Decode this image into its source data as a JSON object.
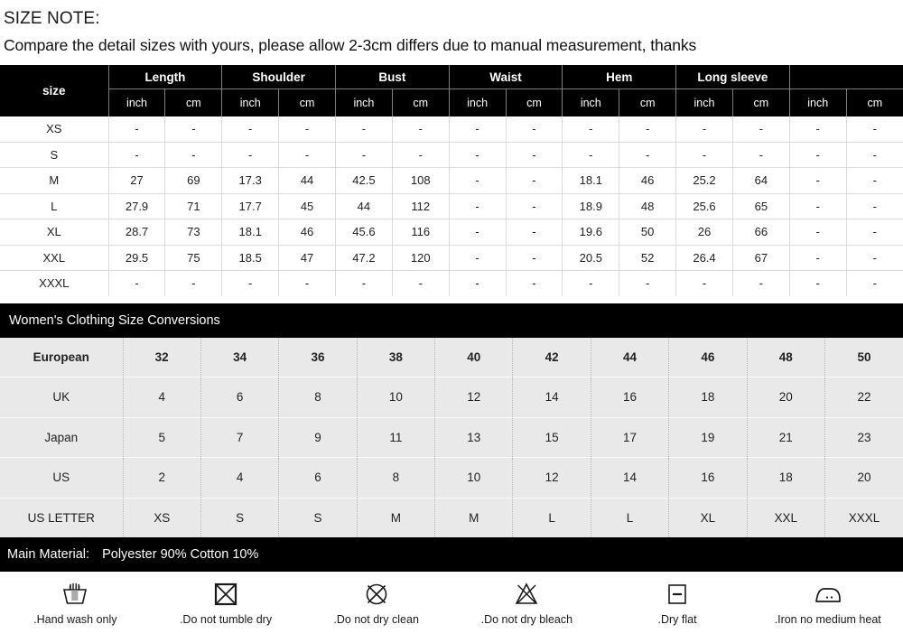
{
  "note": {
    "title": "SIZE NOTE:",
    "text": "Compare the detail sizes with yours, please allow 2-3cm differs due to manual measurement, thanks"
  },
  "size_table": {
    "size_header": "size",
    "groups": [
      {
        "label": "Length",
        "sub": [
          "inch",
          "cm"
        ]
      },
      {
        "label": "Shoulder",
        "sub": [
          "inch",
          "cm"
        ]
      },
      {
        "label": "Bust",
        "sub": [
          "inch",
          "cm"
        ]
      },
      {
        "label": "Waist",
        "sub": [
          "inch",
          "cm"
        ]
      },
      {
        "label": "Hem",
        "sub": [
          "inch",
          "cm"
        ]
      },
      {
        "label": "Long sleeve",
        "sub": [
          "inch",
          "cm"
        ]
      },
      {
        "label": "",
        "sub": [
          "inch",
          "cm"
        ]
      }
    ],
    "rows": [
      {
        "size": "XS",
        "values": [
          "-",
          "-",
          "-",
          "-",
          "-",
          "-",
          "-",
          "-",
          "-",
          "-",
          "-",
          "-",
          "-",
          "-"
        ]
      },
      {
        "size": "S",
        "values": [
          "-",
          "-",
          "-",
          "-",
          "-",
          "-",
          "-",
          "-",
          "-",
          "-",
          "-",
          "-",
          "-",
          "-"
        ]
      },
      {
        "size": "M",
        "values": [
          "27",
          "69",
          "17.3",
          "44",
          "42.5",
          "108",
          "-",
          "-",
          "18.1",
          "46",
          "25.2",
          "64",
          "-",
          "-"
        ]
      },
      {
        "size": "L",
        "values": [
          "27.9",
          "71",
          "17.7",
          "45",
          "44",
          "112",
          "-",
          "-",
          "18.9",
          "48",
          "25.6",
          "65",
          "-",
          "-"
        ]
      },
      {
        "size": "XL",
        "values": [
          "28.7",
          "73",
          "18.1",
          "46",
          "45.6",
          "116",
          "-",
          "-",
          "19.6",
          "50",
          "26",
          "66",
          "-",
          "-"
        ]
      },
      {
        "size": "XXL",
        "values": [
          "29.5",
          "75",
          "18.5",
          "47",
          "47.2",
          "120",
          "-",
          "-",
          "20.5",
          "52",
          "26.4",
          "67",
          "-",
          "-"
        ]
      },
      {
        "size": "XXXL",
        "values": [
          "-",
          "-",
          "-",
          "-",
          "-",
          "-",
          "-",
          "-",
          "-",
          "-",
          "-",
          "-",
          "-",
          "-"
        ]
      }
    ]
  },
  "conversions": {
    "title": "Women's Clothing Size Conversions",
    "rows": [
      {
        "label": "European",
        "values": [
          "32",
          "34",
          "36",
          "38",
          "40",
          "42",
          "44",
          "46",
          "48",
          "50"
        ]
      },
      {
        "label": "UK",
        "values": [
          "4",
          "6",
          "8",
          "10",
          "12",
          "14",
          "16",
          "18",
          "20",
          "22"
        ]
      },
      {
        "label": "Japan",
        "values": [
          "5",
          "7",
          "9",
          "11",
          "13",
          "15",
          "17",
          "19",
          "21",
          "23"
        ]
      },
      {
        "label": "US",
        "values": [
          "2",
          "4",
          "6",
          "8",
          "10",
          "12",
          "14",
          "16",
          "18",
          "20"
        ]
      },
      {
        "label": "US LETTER",
        "values": [
          "XS",
          "S",
          "S",
          "M",
          "M",
          "L",
          "L",
          "XL",
          "XXL",
          "XXXL"
        ]
      }
    ]
  },
  "material": {
    "label": "Main Material:",
    "value": "Polyester 90% Cotton 10%"
  },
  "care": [
    {
      "icon": "hand-wash-icon",
      "label": ".Hand wash only"
    },
    {
      "icon": "do-not-tumble-dry-icon",
      "label": ".Do not tumble dry"
    },
    {
      "icon": "do-not-dry-clean-icon",
      "label": ".Do not dry clean"
    },
    {
      "icon": "do-not-bleach-icon",
      "label": ".Do not dry bleach"
    },
    {
      "icon": "dry-flat-icon",
      "label": ".Dry flat"
    },
    {
      "icon": "iron-medium-heat-icon",
      "label": ".Iron no medium heat"
    }
  ],
  "colors": {
    "header_bg": "#000000",
    "header_text": "#ffffff",
    "body_bg": "#ffffff",
    "conversion_row_bg": "#e9e9e9",
    "grid_line": "#dcdcdc"
  }
}
